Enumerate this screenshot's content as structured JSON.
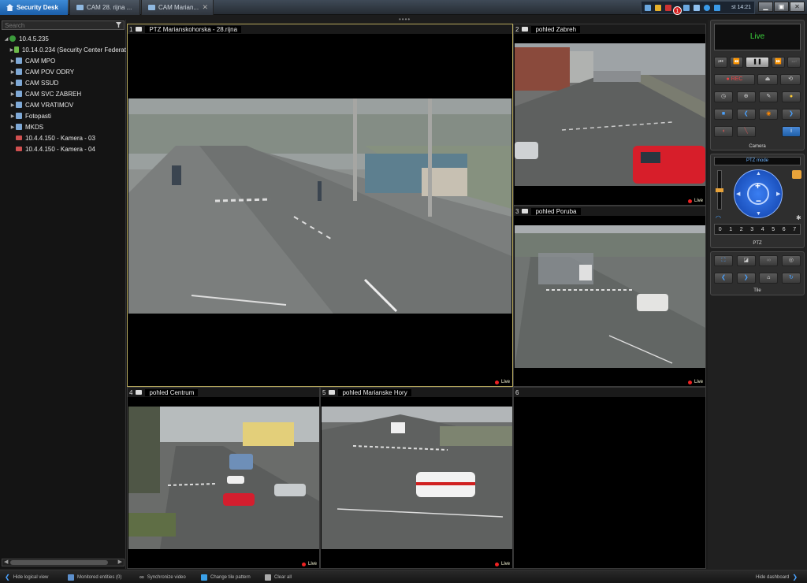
{
  "tabs": [
    {
      "label": "Security Desk"
    },
    {
      "label": "CAM 28. rijna ..."
    },
    {
      "label": "CAM Marian..."
    }
  ],
  "tray": {
    "alert_count": "1",
    "clock": "st 14:21"
  },
  "search": {
    "placeholder": "Search"
  },
  "tree": {
    "root": "10.4.5.235",
    "items": [
      "10.14.0.234 (Security Center Federat",
      "CAM MPO",
      "CAM POV ODRY",
      "CAM SSUD",
      "CAM SVC ZABREH",
      "CAM VRATIMOV",
      "Fotopasti",
      "MKDS",
      "10.4.4.150 - Kamera - 03",
      "10.4.4.150 - Kamera - 04"
    ]
  },
  "tiles": [
    {
      "num": "1",
      "name": "PTZ Marianskohorska - 28.rijna",
      "live": "Live"
    },
    {
      "num": "2",
      "name": "pohled Zabreh",
      "live": "Live"
    },
    {
      "num": "3",
      "name": "pohled Poruba",
      "live": "Live"
    },
    {
      "num": "4",
      "name": "pohled Centrum",
      "live": "Live"
    },
    {
      "num": "5",
      "name": "pohled Marianske Hory",
      "live": "Live"
    },
    {
      "num": "6"
    }
  ],
  "camera_widget": {
    "status": "Live",
    "rec": "REC",
    "title": "Camera"
  },
  "ptz_widget": {
    "mode": "PTZ mode",
    "title": "PTZ",
    "presets": [
      "0",
      "1",
      "2",
      "3",
      "4",
      "5",
      "6",
      "7"
    ]
  },
  "tile_widget": {
    "title": "Tile"
  },
  "bottombar": {
    "hide_logical": "Hide logical view",
    "monitored": "Monitored entities (0)",
    "sync": "Synchronize video",
    "pattern": "Change tile pattern",
    "clear": "Clear all",
    "hide_dashboard": "Hide dashboard"
  }
}
